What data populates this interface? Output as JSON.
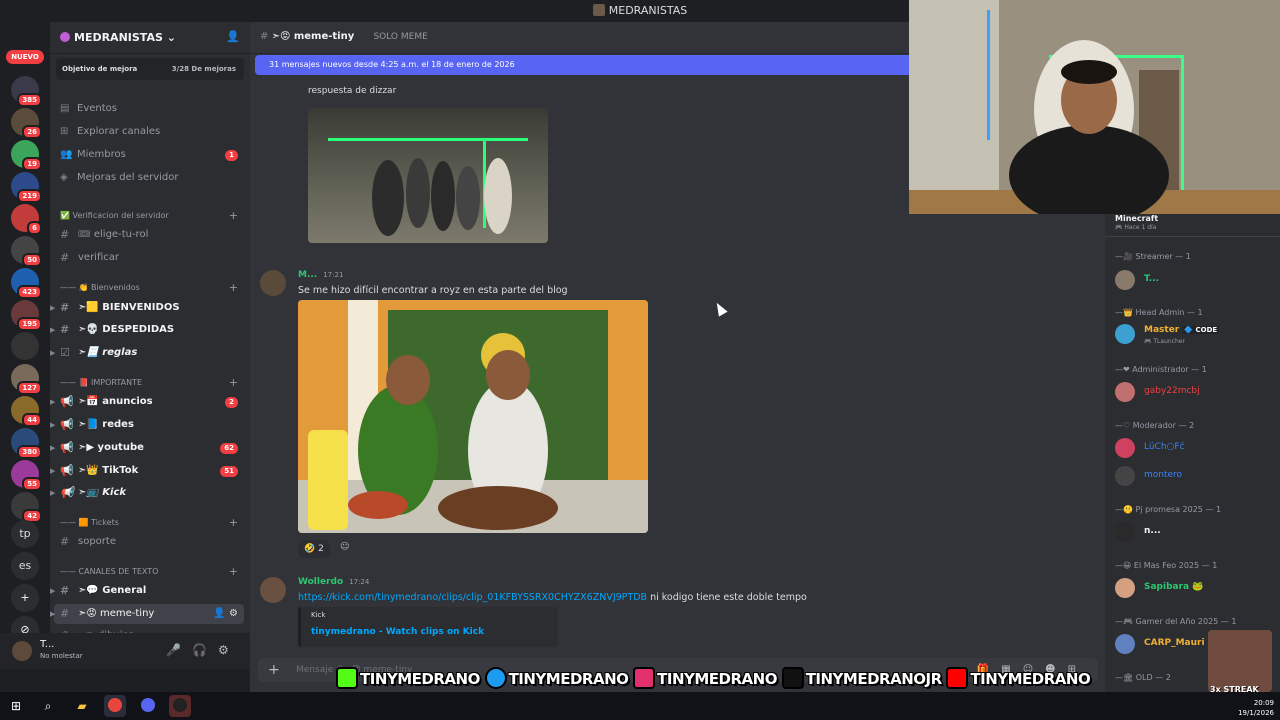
{
  "window_title": "MEDRANISTAS",
  "rail": {
    "new_label": "NUEVO",
    "badges": [
      "385",
      "26",
      "19",
      "219",
      "6",
      "50",
      "423",
      "195",
      "127",
      "44",
      "380",
      "55",
      "42"
    ],
    "text_items": [
      "tp",
      "es"
    ]
  },
  "server": {
    "name": "MEDRANISTAS",
    "boost_label": "Objetivo de mejora",
    "boost_progress": "3/28 De mejoras",
    "nav": [
      {
        "label": "Eventos"
      },
      {
        "label": "Explorar canales"
      },
      {
        "label": "Miembros",
        "badge": "1"
      },
      {
        "label": "Mejoras del servidor"
      }
    ],
    "categories": {
      "verif": "✅ Verificacion del servidor",
      "bienvenidos": "—— 👏 Bienvenidos",
      "importante": "—— 📕 IMPORTANTE",
      "tickets": "—— 🟧 Tickets",
      "texto": "—— CANALES DE TEXTO"
    },
    "channels": {
      "elige": "🎟 elige-tu-rol",
      "verificar": "verificar",
      "bienvenidos": "➣🟨 BIENVENIDOS",
      "despedidas": "➣💀 DESPEDIDAS",
      "reglas": "➣📃 reglas",
      "anuncios": "➣📅 anuncios",
      "anuncios_badge": "2",
      "redes": "➣📘 redes",
      "youtube": "➣▶ youtube",
      "youtube_badge": "62",
      "tiktok": "➣👑 TikTok",
      "tiktok_badge": "51",
      "kick": "➣📺 Kick",
      "soporte": "soporte",
      "general": "➣💬 General",
      "meme": "➣😡 meme-tiny",
      "dibujos": "➣✏ dibujos"
    }
  },
  "user_panel": {
    "name": "T...",
    "status": "No molestar"
  },
  "channel": {
    "name": "➣😡 meme-tiny",
    "topic": "SOLO MEME",
    "new_messages": "31 mensajes nuevos desde 4:25 a.m. el 18 de enero de 2026",
    "input_placeholder": "Mensaje #➣😡 meme-tiny"
  },
  "messages": [
    {
      "reply_text": "respuesta de dizzar"
    },
    {
      "author": "M...",
      "time": "17:21",
      "text": "Se me hizo difícil encontrar a royz en esta parte del blog",
      "reaction_count": "2"
    },
    {
      "author": "Wollerdo",
      "time": "17:24",
      "link": "https://kick.com/tinymedrano/clips/clip_01KFBYSSRX0CHYZX6ZNVJ9PTDB",
      "text": "ni kodigo tiene este doble tempo",
      "embed_provider": "Kick",
      "embed_title": "tinymedrano - Watch clips on Kick"
    }
  ],
  "members": {
    "activity": {
      "name": "Minecraft",
      "sub": "🎮 Hace 1 día"
    },
    "groups": [
      {
        "role": "—🎥 Streamer — 1",
        "members": [
          {
            "name": "T...",
            "color": "#2dc770"
          }
        ]
      },
      {
        "role": "—👑 Head Admin — 1",
        "members": [
          {
            "name": "Master",
            "tag": "🔷 CODE",
            "sub": "🎮 TLauncher",
            "color": "#f0b132"
          }
        ]
      },
      {
        "role": "—❤ Administrador — 1",
        "members": [
          {
            "name": "gaby22mcbj",
            "color": "#f23f43"
          }
        ]
      },
      {
        "role": "—♡ Moderador — 2",
        "members": [
          {
            "name": "LüCh○Fč",
            "color": "#3b82f6"
          },
          {
            "name": "montero",
            "color": "#3b82f6"
          }
        ]
      },
      {
        "role": "—🤫 Pj promesa 2025 — 1",
        "members": [
          {
            "name": "n...",
            "color": "#f2f3f5"
          }
        ]
      },
      {
        "role": "—😀 El Mas Feo 2025 — 1",
        "members": [
          {
            "name": "Sapibara 🐸",
            "color": "#2dc770"
          }
        ]
      },
      {
        "role": "—🎮 Gamer del Año 2025 — 1",
        "members": [
          {
            "name": "CARP_Mauri",
            "color": "#f0b132"
          }
        ]
      },
      {
        "role": "—🏛 OLD — 2",
        "members": []
      }
    ]
  },
  "overlay": {
    "socials": [
      "TINYMEDRANO",
      "TINYMEDRANO",
      "TINYMEDRANO",
      "TINYMEDRANOJR",
      "TINYMEDRANO"
    ],
    "streak": "3x STREAK"
  },
  "clock": {
    "time": "20:09",
    "date": "19/1/2026"
  },
  "colors": {
    "accent": "#5865f2",
    "danger": "#f23f43",
    "link": "#00a8fc"
  }
}
